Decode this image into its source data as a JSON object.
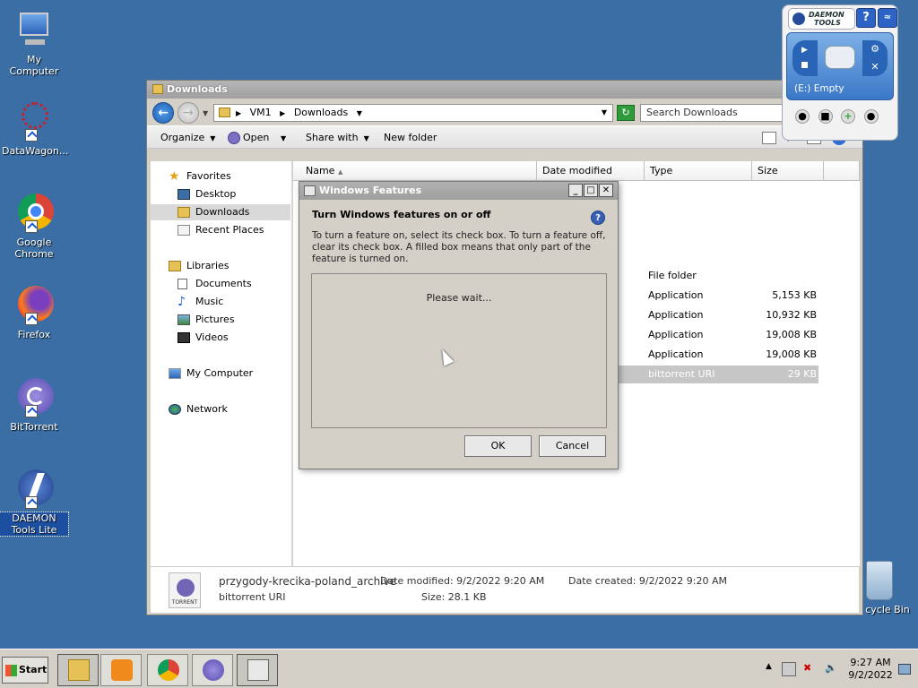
{
  "desktop": {
    "icons": [
      {
        "label": "My Computer",
        "icon": "my-computer-icon"
      },
      {
        "label": "DataWagon...",
        "icon": "datawagon-icon"
      },
      {
        "label": "Google Chrome",
        "icon": "chrome-icon"
      },
      {
        "label": "Firefox",
        "icon": "firefox-icon"
      },
      {
        "label": "BitTorrent",
        "icon": "bittorrent-icon"
      },
      {
        "label": "DAEMON Tools Lite",
        "icon": "daemon-tools-icon"
      }
    ],
    "recycle_label": "cycle Bin"
  },
  "explorer": {
    "title": "Downloads",
    "address": {
      "seg1": "VM1",
      "seg2": "Downloads"
    },
    "search_placeholder": "Search Downloads",
    "commands": {
      "organize": "Organize",
      "open": "Open",
      "share": "Share with",
      "new_folder": "New folder"
    },
    "nav": {
      "favorites": "Favorites",
      "desktop": "Desktop",
      "downloads": "Downloads",
      "recent": "Recent Places",
      "libraries": "Libraries",
      "documents": "Documents",
      "music": "Music",
      "pictures": "Pictures",
      "videos": "Videos",
      "my_computer": "My Computer",
      "network": "Network"
    },
    "columns": {
      "name": "Name",
      "date": "Date modified",
      "type": "Type",
      "size": "Size"
    },
    "rows": [
      {
        "type": "File folder",
        "size": ""
      },
      {
        "type": "Application",
        "size": "5,153 KB"
      },
      {
        "type": "Application",
        "size": "10,932 KB"
      },
      {
        "type": "Application",
        "size": "19,008 KB"
      },
      {
        "type": "Application",
        "size": "19,008 KB"
      },
      {
        "type": "bittorrent URI",
        "size": "29 KB"
      }
    ],
    "details": {
      "filename": "przygody-krecika-poland_archive",
      "filetype": "bittorrent URI",
      "modified": "Date modified: 9/2/2022 9:20 AM",
      "size": "Size: 28.1 KB",
      "created": "Date created: 9/2/2022 9:20 AM",
      "icon_text": "TORRENT"
    }
  },
  "dialog": {
    "title": "Windows Features",
    "heading": "Turn Windows features on or off",
    "description": "To turn a feature on, select its check box. To turn a feature off, clear its check box. A filled box means that only part of the feature is turned on.",
    "wait": "Please wait...",
    "ok": "OK",
    "cancel": "Cancel"
  },
  "daemon": {
    "logo_line1": "DAEMON",
    "logo_line2": "TOOLS",
    "drive": "(E:) Empty"
  },
  "taskbar": {
    "start": "Start",
    "time": "9:27 AM",
    "date": "9/2/2022"
  }
}
